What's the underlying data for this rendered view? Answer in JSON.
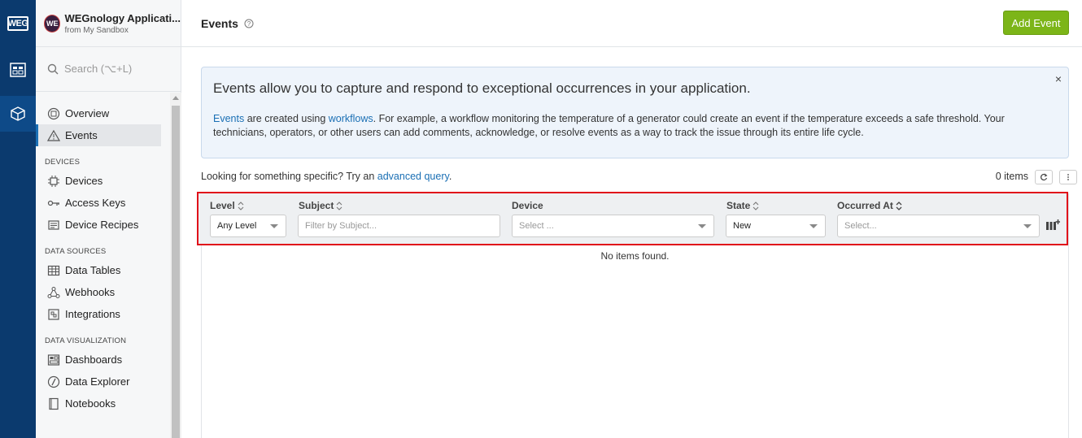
{
  "rail": {
    "logo": "WEG",
    "items": [
      {
        "icon": "org-dashboard-icon"
      },
      {
        "icon": "application-cube-icon"
      }
    ]
  },
  "app": {
    "avatar": "WE",
    "name": "WEGnology Applicati...",
    "subtitle": "from My Sandbox"
  },
  "search": {
    "placeholder": "Search (⌥+L)"
  },
  "sidebar": {
    "top_items": [
      {
        "label": "Overview",
        "icon": "overview-icon"
      },
      {
        "label": "Events",
        "icon": "warning-triangle-icon",
        "active": true
      }
    ],
    "sections": [
      {
        "title": "DEVICES",
        "items": [
          {
            "label": "Devices",
            "icon": "chip-icon"
          },
          {
            "label": "Access Keys",
            "icon": "key-icon"
          },
          {
            "label": "Device Recipes",
            "icon": "recipe-icon"
          }
        ]
      },
      {
        "title": "DATA SOURCES",
        "items": [
          {
            "label": "Data Tables",
            "icon": "table-icon"
          },
          {
            "label": "Webhooks",
            "icon": "webhook-icon"
          },
          {
            "label": "Integrations",
            "icon": "integration-icon"
          }
        ]
      },
      {
        "title": "DATA VISUALIZATION",
        "items": [
          {
            "label": "Dashboards",
            "icon": "dashboard-icon"
          },
          {
            "label": "Data Explorer",
            "icon": "compass-icon"
          },
          {
            "label": "Notebooks",
            "icon": "notebook-icon"
          }
        ]
      }
    ]
  },
  "header": {
    "title": "Events",
    "add_button": "Add Event"
  },
  "info": {
    "heading": "Events allow you to capture and respond to exceptional occurrences in your application.",
    "link1": "Events",
    "text1": " are created using ",
    "link2": "workflows",
    "text2": ". For example, a workflow monitoring the temperature of a generator could create an event if the temperature exceeds a safe threshold. Your technicians, operators, or other users can add comments, acknowledge, or resolve events as a way to track the issue through its entire life cycle.",
    "close": "×"
  },
  "query": {
    "text": "Looking for something specific? Try an ",
    "link": "advanced query",
    "suffix": ".",
    "count": "0 items"
  },
  "filters": {
    "level": {
      "header": "Level",
      "value": "Any Level"
    },
    "subject": {
      "header": "Subject",
      "placeholder": "Filter by Subject..."
    },
    "device": {
      "header": "Device",
      "placeholder": "Select ..."
    },
    "state": {
      "header": "State",
      "value": "New"
    },
    "occurred": {
      "header": "Occurred At",
      "placeholder": "Select..."
    }
  },
  "empty_text": "No items found."
}
